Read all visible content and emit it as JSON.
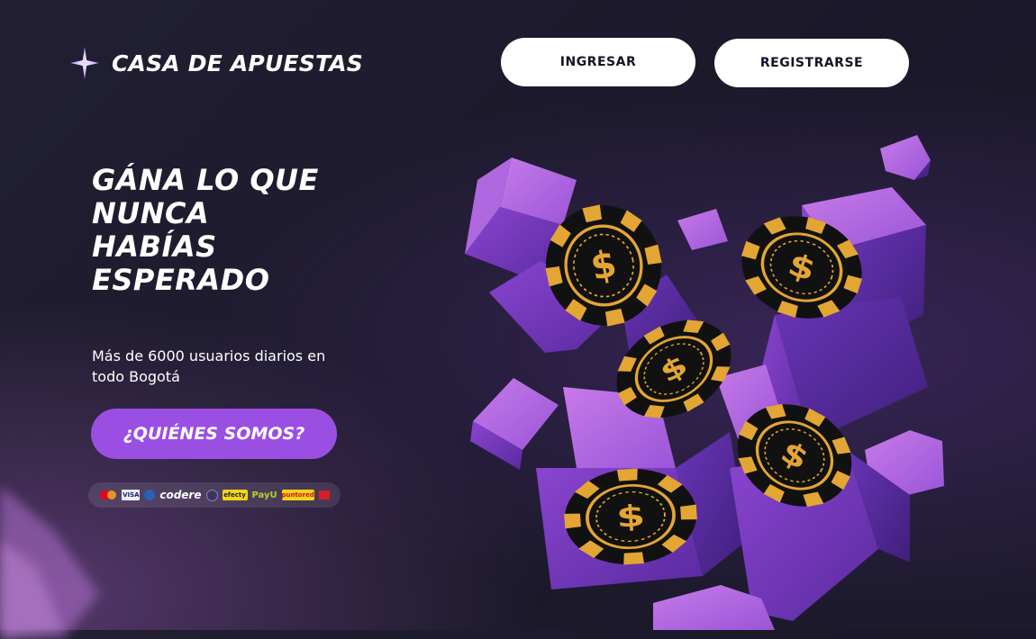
{
  "header": {
    "logo_text": "CASA DE APUESTAS",
    "login_label": "INGRESAR",
    "register_label": "REGISTRARSE"
  },
  "hero": {
    "title": "GÁNA LO QUE NUNCA HABÍAS ESPERADO",
    "subtitle": "Más de 6000 usuarios diarios en todo Bogotá",
    "cta_label": "¿QUIÉNES SOMOS?"
  },
  "payments": {
    "codere": "codere",
    "visa": "VISA",
    "efecty": "efecty",
    "payu": "PayU",
    "puntored": "puntored"
  },
  "colors": {
    "background": "#1c1a2e",
    "accent": "#9b4fe2",
    "cube": "#8a45d6",
    "chip_gold": "#e3a534",
    "chip_black": "#111111"
  },
  "icons": {
    "logo": "sparkle-star-icon",
    "chip": "dollar-casino-chip-icon"
  }
}
